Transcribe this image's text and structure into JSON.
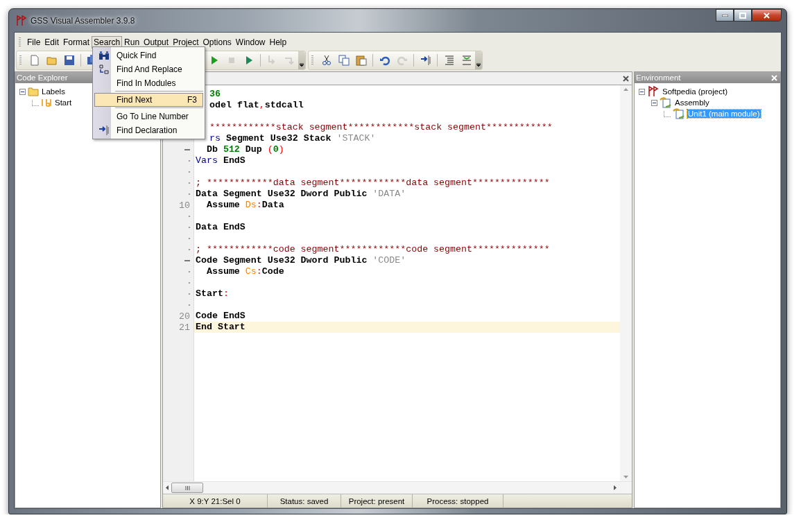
{
  "window": {
    "title": "GSS Visual Assembler 3.9.8"
  },
  "menu_bar": [
    {
      "label": "File",
      "selected": false
    },
    {
      "label": "Edit",
      "selected": false
    },
    {
      "label": "Format",
      "selected": false
    },
    {
      "label": "Search",
      "selected": true
    },
    {
      "label": "Run",
      "selected": false
    },
    {
      "label": "Output",
      "selected": false
    },
    {
      "label": "Project",
      "selected": false
    },
    {
      "label": "Options",
      "selected": false
    },
    {
      "label": "Window",
      "selected": false
    },
    {
      "label": "Help",
      "selected": false
    }
  ],
  "search_menu": [
    {
      "kind": "binoculars",
      "label": "Quick Find",
      "selected": false
    },
    {
      "kind": "replace",
      "label": "Find And Replace",
      "selected": false
    },
    {
      "kind": "plain",
      "label": "Find In Modules",
      "selected": false
    },
    {
      "kind": "separator"
    },
    {
      "kind": "plain",
      "label": "Find Next",
      "shortcut": "F3",
      "selected": true
    },
    {
      "kind": "separator"
    },
    {
      "kind": "plain",
      "label": "Go To Line Number",
      "selected": false
    },
    {
      "kind": "declaration",
      "label": "Find Declaration",
      "selected": false
    }
  ],
  "toolbar": [
    {
      "kind": "new",
      "disabled": false
    },
    {
      "kind": "open",
      "disabled": false
    },
    {
      "kind": "save",
      "disabled": false
    },
    {
      "kind": "separator"
    },
    {
      "kind": "saveall",
      "disabled": false
    },
    {
      "kind": "gap"
    },
    {
      "kind": "run",
      "disabled": false
    },
    {
      "kind": "stop",
      "disabled": true
    },
    {
      "kind": "step",
      "disabled": false
    },
    {
      "kind": "separator"
    },
    {
      "kind": "stepinto",
      "disabled": true
    },
    {
      "kind": "stepover",
      "disabled": true
    },
    {
      "kind": "chevron"
    },
    {
      "kind": "band"
    },
    {
      "kind": "cut",
      "disabled": false
    },
    {
      "kind": "copy",
      "disabled": false
    },
    {
      "kind": "paste",
      "disabled": false
    },
    {
      "kind": "separator"
    },
    {
      "kind": "undo",
      "disabled": false
    },
    {
      "kind": "redo",
      "disabled": true
    },
    {
      "kind": "separator"
    },
    {
      "kind": "insert",
      "disabled": false
    },
    {
      "kind": "separator"
    },
    {
      "kind": "indent",
      "disabled": false
    },
    {
      "kind": "outdent",
      "disabled": false
    },
    {
      "kind": "chevron"
    }
  ],
  "code_explorer": {
    "title": "Code Explorer",
    "tree": [
      {
        "label": "Labels",
        "kind": "folder",
        "expanded": true,
        "selected": false,
        "children": [
          {
            "label": "Start",
            "kind": "label",
            "selected": false
          }
        ]
      }
    ]
  },
  "editor": {
    "lines": [
      {
        "kind": "partial",
        "tokens": [
          {
            "t": "36",
            "kind": "num"
          }
        ]
      },
      {
        "kind": "partial",
        "tokens": [
          {
            "t": "odel flat",
            "kind": "kw"
          },
          {
            "t": ",",
            "kind": "punct"
          },
          {
            "t": "stdcall",
            "kind": "kw"
          }
        ]
      },
      {
        "kind": "code"
      },
      {
        "kind": "partial",
        "tokens": [
          {
            "t": "************stack segment************stack segment************",
            "kind": "cmt"
          }
        ]
      },
      {
        "kind": "partial",
        "tokens": [
          {
            "t": "rs",
            "kind": "id"
          },
          {
            "t": " Segment Use32 Stack ",
            "kind": "kw"
          },
          {
            "t": "'STACK'",
            "kind": "str"
          }
        ]
      },
      {
        "kind": "code",
        "fold": true,
        "tokens": [
          {
            "t": "  Db ",
            "kind": "kw"
          },
          {
            "t": "512",
            "kind": "num"
          },
          {
            "t": " Dup ",
            "kind": "kw"
          },
          {
            "t": "(",
            "kind": "punct"
          },
          {
            "t": "0",
            "kind": "num"
          },
          {
            "t": ")",
            "kind": "punct"
          }
        ]
      },
      {
        "kind": "code",
        "fold": false,
        "tokens": [
          {
            "t": "Vars",
            "kind": "id"
          },
          {
            "t": " EndS",
            "kind": "kw"
          }
        ]
      },
      {
        "kind": "code",
        "fold": false
      },
      {
        "kind": "code",
        "fold": false,
        "tokens": [
          {
            "t": "; ************data segment************data segment**************",
            "kind": "cmt"
          }
        ]
      },
      {
        "kind": "code",
        "fold": false,
        "tokens": [
          {
            "t": "Data Segment Use32 Dword Public ",
            "kind": "kw"
          },
          {
            "t": "'DATA'",
            "kind": "str"
          }
        ]
      },
      {
        "kind": "code",
        "number": "10",
        "tokens": [
          {
            "t": "  Assume ",
            "kind": "kw"
          },
          {
            "t": "Ds",
            "kind": "reg"
          },
          {
            "t": ":",
            "kind": "punct"
          },
          {
            "t": "Data",
            "kind": "kw"
          }
        ]
      },
      {
        "kind": "code",
        "fold": false
      },
      {
        "kind": "code",
        "fold": false,
        "tokens": [
          {
            "t": "Data EndS",
            "kind": "kw"
          }
        ]
      },
      {
        "kind": "code",
        "fold": false
      },
      {
        "kind": "code",
        "fold": false,
        "tokens": [
          {
            "t": "; ************code segment************code segment**************",
            "kind": "cmt"
          }
        ]
      },
      {
        "kind": "code",
        "fold": true,
        "tokens": [
          {
            "t": "Code Segment Use32 Dword Public ",
            "kind": "kw"
          },
          {
            "t": "'CODE'",
            "kind": "str"
          }
        ]
      },
      {
        "kind": "code",
        "fold": false,
        "tokens": [
          {
            "t": "  Assume ",
            "kind": "kw"
          },
          {
            "t": "Cs",
            "kind": "reg"
          },
          {
            "t": ":",
            "kind": "punct"
          },
          {
            "t": "Code",
            "kind": "kw"
          }
        ]
      },
      {
        "kind": "code",
        "fold": false
      },
      {
        "kind": "code",
        "fold": false,
        "tokens": [
          {
            "t": "Start",
            "kind": "kw"
          },
          {
            "t": ":",
            "kind": "punct"
          }
        ]
      },
      {
        "kind": "code",
        "fold": false
      },
      {
        "kind": "code",
        "number": "20",
        "tokens": [
          {
            "t": "Code EndS",
            "kind": "kw"
          }
        ]
      },
      {
        "kind": "code",
        "number": "21",
        "current": true,
        "tokens": [
          {
            "t": "End Start",
            "kind": "kw"
          }
        ]
      }
    ]
  },
  "environment": {
    "title": "Environment",
    "tree": [
      {
        "label": "Softpedia (project)",
        "kind": "project",
        "expanded": true,
        "selected": false,
        "children": [
          {
            "label": "Assembly",
            "kind": "module",
            "expanded": true,
            "selected": false,
            "children": [
              {
                "label": "Unit1 (main module)",
                "kind": "module",
                "selected": true
              }
            ]
          }
        ]
      }
    ]
  },
  "status_bar": [
    "X 9:Y 21:Sel 0",
    "Status: saved",
    "Project: present",
    "Process: stopped"
  ]
}
